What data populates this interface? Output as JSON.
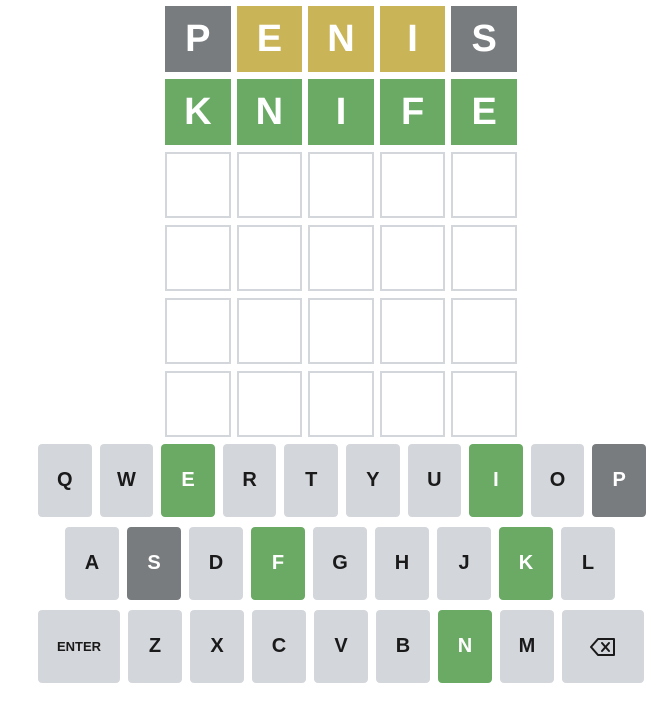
{
  "board": {
    "rows": [
      [
        {
          "letter": "P",
          "state": "absent"
        },
        {
          "letter": "E",
          "state": "present"
        },
        {
          "letter": "N",
          "state": "present"
        },
        {
          "letter": "I",
          "state": "present"
        },
        {
          "letter": "S",
          "state": "absent"
        }
      ],
      [
        {
          "letter": "K",
          "state": "correct"
        },
        {
          "letter": "N",
          "state": "correct"
        },
        {
          "letter": "I",
          "state": "correct"
        },
        {
          "letter": "F",
          "state": "correct"
        },
        {
          "letter": "E",
          "state": "correct"
        }
      ],
      [
        {
          "letter": "",
          "state": "empty"
        },
        {
          "letter": "",
          "state": "empty"
        },
        {
          "letter": "",
          "state": "empty"
        },
        {
          "letter": "",
          "state": "empty"
        },
        {
          "letter": "",
          "state": "empty"
        }
      ],
      [
        {
          "letter": "",
          "state": "empty"
        },
        {
          "letter": "",
          "state": "empty"
        },
        {
          "letter": "",
          "state": "empty"
        },
        {
          "letter": "",
          "state": "empty"
        },
        {
          "letter": "",
          "state": "empty"
        }
      ],
      [
        {
          "letter": "",
          "state": "empty"
        },
        {
          "letter": "",
          "state": "empty"
        },
        {
          "letter": "",
          "state": "empty"
        },
        {
          "letter": "",
          "state": "empty"
        },
        {
          "letter": "",
          "state": "empty"
        }
      ],
      [
        {
          "letter": "",
          "state": "empty"
        },
        {
          "letter": "",
          "state": "empty"
        },
        {
          "letter": "",
          "state": "empty"
        },
        {
          "letter": "",
          "state": "empty"
        },
        {
          "letter": "",
          "state": "empty"
        }
      ]
    ]
  },
  "keyboard": {
    "row1": [
      {
        "label": "Q",
        "state": "unused"
      },
      {
        "label": "W",
        "state": "unused"
      },
      {
        "label": "E",
        "state": "correct"
      },
      {
        "label": "R",
        "state": "unused"
      },
      {
        "label": "T",
        "state": "unused"
      },
      {
        "label": "Y",
        "state": "unused"
      },
      {
        "label": "U",
        "state": "unused"
      },
      {
        "label": "I",
        "state": "correct"
      },
      {
        "label": "O",
        "state": "unused"
      },
      {
        "label": "P",
        "state": "absent"
      }
    ],
    "row2": [
      {
        "label": "A",
        "state": "unused"
      },
      {
        "label": "S",
        "state": "absent"
      },
      {
        "label": "D",
        "state": "unused"
      },
      {
        "label": "F",
        "state": "correct"
      },
      {
        "label": "G",
        "state": "unused"
      },
      {
        "label": "H",
        "state": "unused"
      },
      {
        "label": "J",
        "state": "unused"
      },
      {
        "label": "K",
        "state": "correct"
      },
      {
        "label": "L",
        "state": "unused"
      }
    ],
    "row3": [
      {
        "label": "ENTER",
        "state": "unused",
        "wide": true
      },
      {
        "label": "Z",
        "state": "unused"
      },
      {
        "label": "X",
        "state": "unused"
      },
      {
        "label": "C",
        "state": "unused"
      },
      {
        "label": "V",
        "state": "unused"
      },
      {
        "label": "B",
        "state": "unused"
      },
      {
        "label": "N",
        "state": "correct"
      },
      {
        "label": "M",
        "state": "unused"
      },
      {
        "label": "",
        "state": "unused",
        "wide": true,
        "icon": "backspace-icon"
      }
    ]
  },
  "colors": {
    "correct": "#6aaa64",
    "present": "#c9b458",
    "absent": "#787c7e",
    "key_unused": "#d3d6da",
    "tile_border": "#d3d6da"
  }
}
